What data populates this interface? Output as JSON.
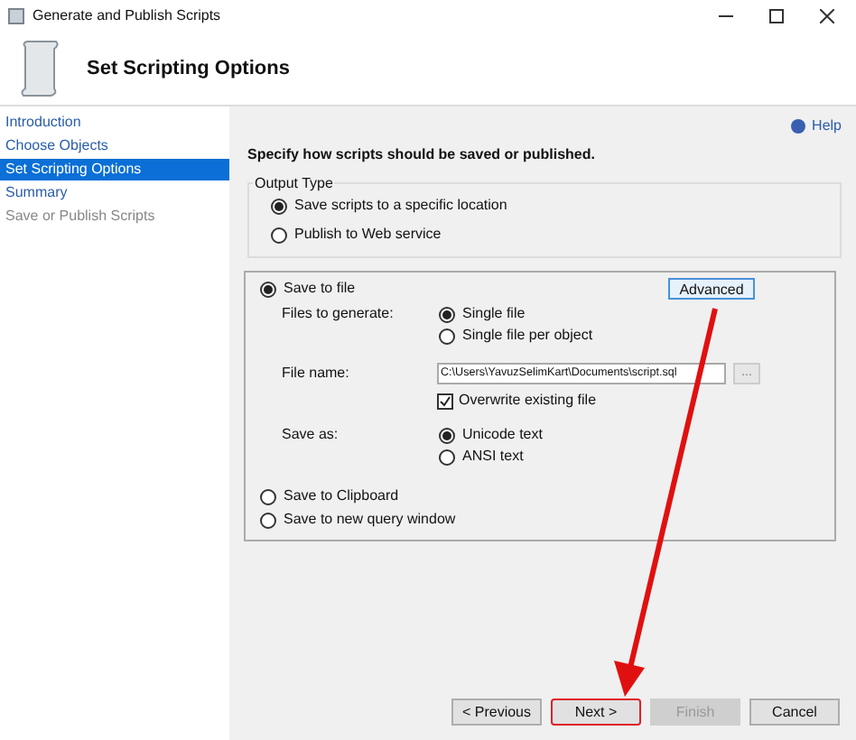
{
  "window": {
    "title": "Generate and Publish Scripts"
  },
  "header": {
    "title": "Set Scripting Options"
  },
  "sidebar": {
    "items": [
      {
        "label": "Introduction",
        "selected": false,
        "disabled": false
      },
      {
        "label": "Choose Objects",
        "selected": false,
        "disabled": false
      },
      {
        "label": "Set Scripting Options",
        "selected": true,
        "disabled": false
      },
      {
        "label": "Summary",
        "selected": false,
        "disabled": false
      },
      {
        "label": "Save or Publish Scripts",
        "selected": false,
        "disabled": true
      }
    ]
  },
  "help": "Help",
  "instruction": "Specify how scripts should be saved or published.",
  "output_type": {
    "legend": "Output Type",
    "options": [
      {
        "label": "Save scripts to a specific location",
        "selected": true
      },
      {
        "label": "Publish to Web service",
        "selected": false
      }
    ]
  },
  "save_to_file": {
    "label": "Save to file",
    "selected": true,
    "advanced": "Advanced",
    "files_label": "Files to generate:",
    "files_options": [
      {
        "label": "Single file",
        "selected": true
      },
      {
        "label": "Single file per object",
        "selected": false
      }
    ],
    "file_name_label": "File name:",
    "file_name": "C:\\Users\\YavuzSelimKart\\Documents\\script.sql",
    "browse": "...",
    "overwrite": {
      "label": "Overwrite existing file",
      "checked": true
    },
    "save_as_label": "Save as:",
    "save_as_options": [
      {
        "label": "Unicode text",
        "selected": true
      },
      {
        "label": "ANSI text",
        "selected": false
      }
    ]
  },
  "other_options": [
    {
      "label": "Save to Clipboard",
      "selected": false
    },
    {
      "label": "Save to new query window",
      "selected": false
    }
  ],
  "buttons": [
    {
      "label": "< Previous",
      "disabled": false,
      "highlighted": false
    },
    {
      "label": "Next >",
      "disabled": false,
      "highlighted": true
    },
    {
      "label": "Finish",
      "disabled": true,
      "highlighted": false
    },
    {
      "label": "Cancel",
      "disabled": false,
      "highlighted": false
    }
  ],
  "annotation": {
    "arrow": true
  }
}
